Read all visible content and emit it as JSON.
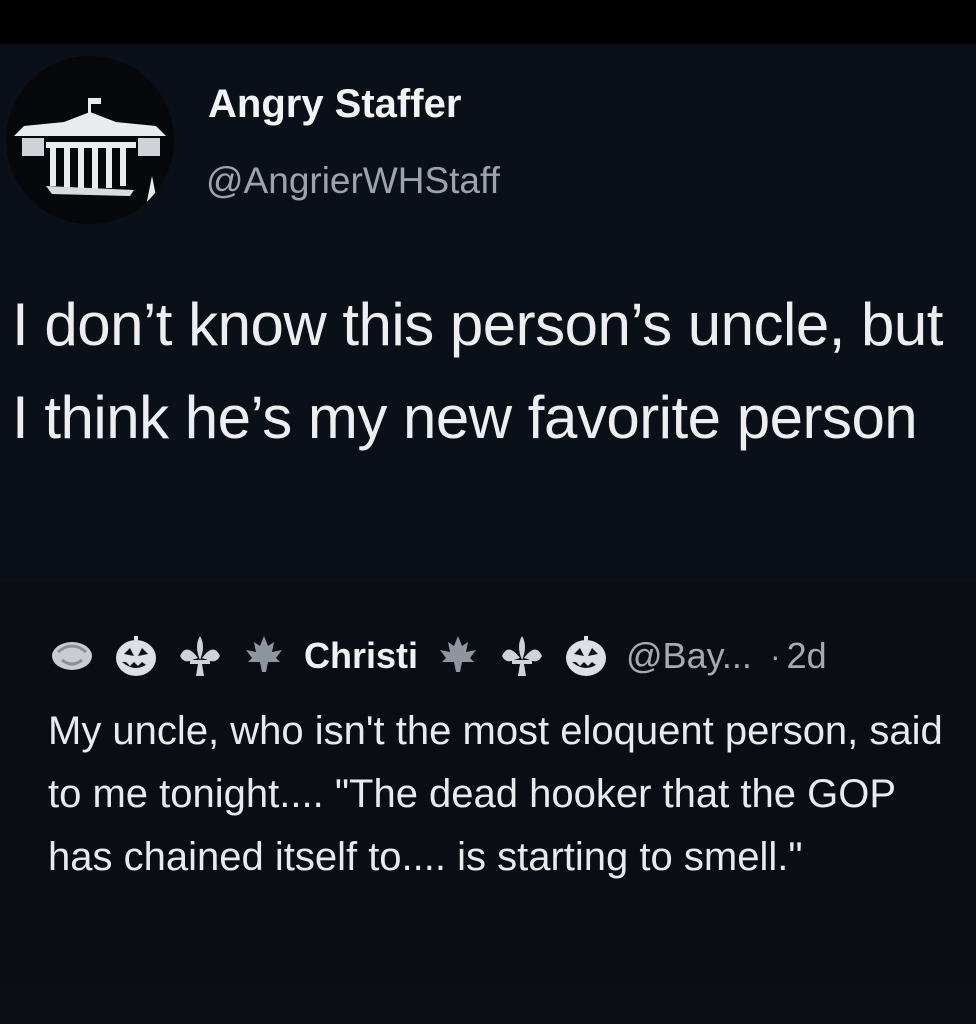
{
  "tweet": {
    "author": {
      "display_name": "Angry Staffer",
      "handle": "@AngrierWHStaff",
      "avatar_icon": "white-house-icon"
    },
    "text": "I don’t know this person’s uncle, but I think he’s my new favorite person"
  },
  "quoted_tweet": {
    "author": {
      "display_name": "Christi",
      "handle": "@Bay...",
      "name_emojis_before": [
        "rose-icon",
        "jack-o-lantern-icon",
        "fleur-de-lis-icon",
        "maple-leaf-icon"
      ],
      "name_emojis_after": [
        "maple-leaf-icon",
        "fleur-de-lis-icon",
        "jack-o-lantern-icon"
      ]
    },
    "separator": "·",
    "time": "2d",
    "text": "My uncle, who isn't the most eloquent person, said to me tonight.... \"The dead hooker that the GOP has chained itself to.... is starting to smell.\""
  },
  "colors": {
    "background": "#0b0f18",
    "primary_text": "#eceef1",
    "secondary_text": "#9da3ab"
  }
}
